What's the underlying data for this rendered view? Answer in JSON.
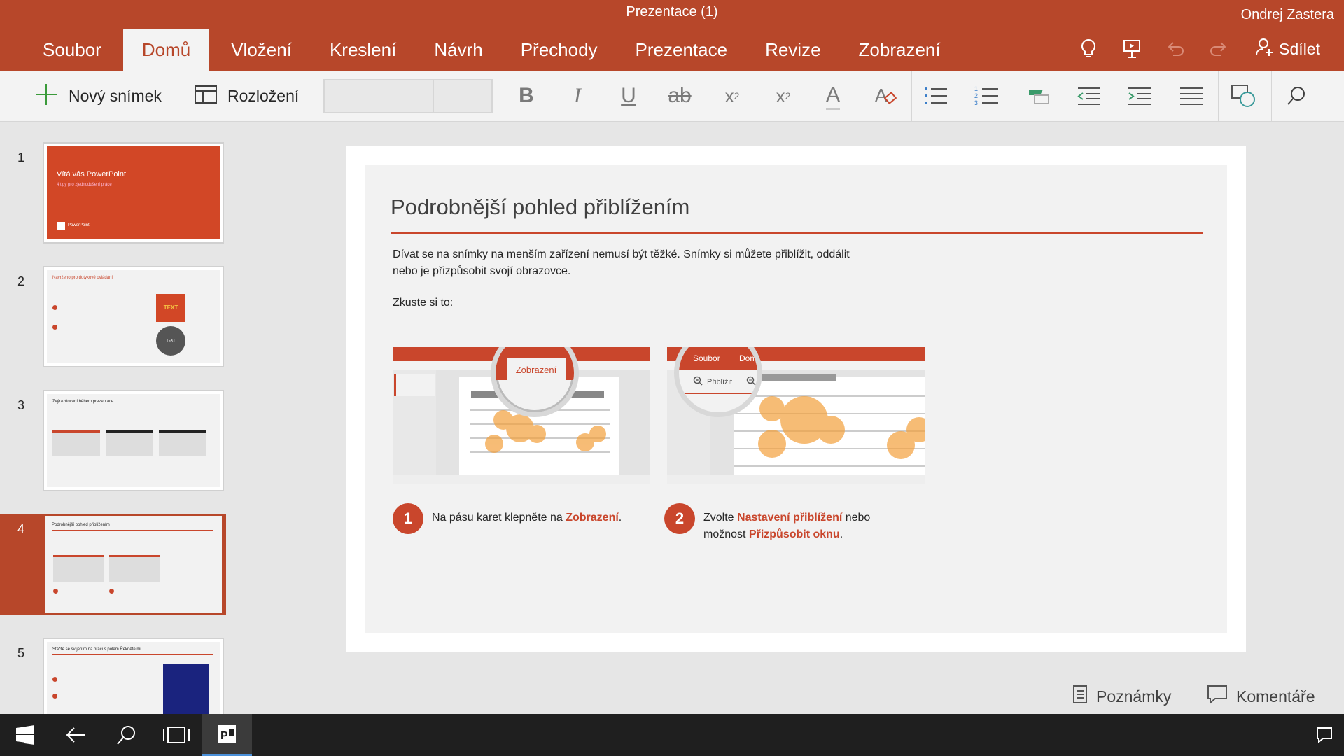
{
  "window": {
    "title": "Prezentace (1)",
    "user": "Ondrej Zastera"
  },
  "tabs": [
    {
      "label": "Soubor"
    },
    {
      "label": "Domů",
      "active": true
    },
    {
      "label": "Vložení"
    },
    {
      "label": "Kreslení"
    },
    {
      "label": "Návrh"
    },
    {
      "label": "Přechody"
    },
    {
      "label": "Prezentace"
    },
    {
      "label": "Revize"
    },
    {
      "label": "Zobrazení"
    }
  ],
  "ribbon_right": {
    "share_label": "Sdílet",
    "icons": [
      "lightbulb-icon",
      "present-icon",
      "undo-icon",
      "redo-icon",
      "share-person-icon"
    ]
  },
  "commands": {
    "new_slide": "Nový snímek",
    "layout": "Rozložení",
    "format_icons": [
      "bold-icon",
      "italic-icon",
      "underline-icon",
      "strikethrough-icon",
      "subscript-icon",
      "superscript-icon",
      "font-color-icon",
      "clear-format-icon",
      "bullets-icon",
      "numbering-icon",
      "highlight-icon",
      "decrease-indent-icon",
      "increase-indent-icon",
      "align-icon",
      "shapes-icon",
      "search-icon"
    ]
  },
  "thumbnails": [
    {
      "number": "1",
      "title": "Vítá vás PowerPoint",
      "subtitle": "4 tipy pro zjednodušení práce",
      "brand": "PowerPoint"
    },
    {
      "number": "2",
      "title": "Navrženo pro dotykové ovládání",
      "badge1": "TEXT",
      "badge2": "TEXT"
    },
    {
      "number": "3",
      "title": "Zvýrazňování během prezentace"
    },
    {
      "number": "4",
      "title": "Podrobnější pohled přiblížením",
      "selected": true
    },
    {
      "number": "5",
      "title": "Stačte se svíjením na práci s polem Řekněte mi"
    }
  ],
  "slide": {
    "title": "Podrobnější pohled přiblížením",
    "body_line1": "Dívat se na snímky na menším zařízení nemusí být těžké. Snímky si můžete přiblížit, oddálit",
    "body_line2": "nebo je přizpůsobit svojí obrazovce.",
    "try": "Zkuste si to:",
    "shot1_magnifier_label": "Zobrazení",
    "shot2_magnifier_tab1": "Soubor",
    "shot2_magnifier_tab2": "Domů",
    "shot2_magnifier_zoom": "Přiblížit",
    "step1": {
      "number": "1",
      "text_before": "Na pásu karet klepněte na ",
      "highlight": "Zobrazení",
      "text_after": "."
    },
    "step2": {
      "number": "2",
      "text_before": "Zvolte ",
      "highlight": "Nastavení přiblížení",
      "text_mid": " nebo",
      "text_line2_before": "možnost ",
      "highlight2": "Přizpůsobit oknu",
      "text_after": "."
    }
  },
  "bottom": {
    "notes": "Poznámky",
    "comments": "Komentáře"
  },
  "colors": {
    "accent": "#b7472a",
    "slide_accent": "#c9462c",
    "circle": "#f3a03c"
  }
}
